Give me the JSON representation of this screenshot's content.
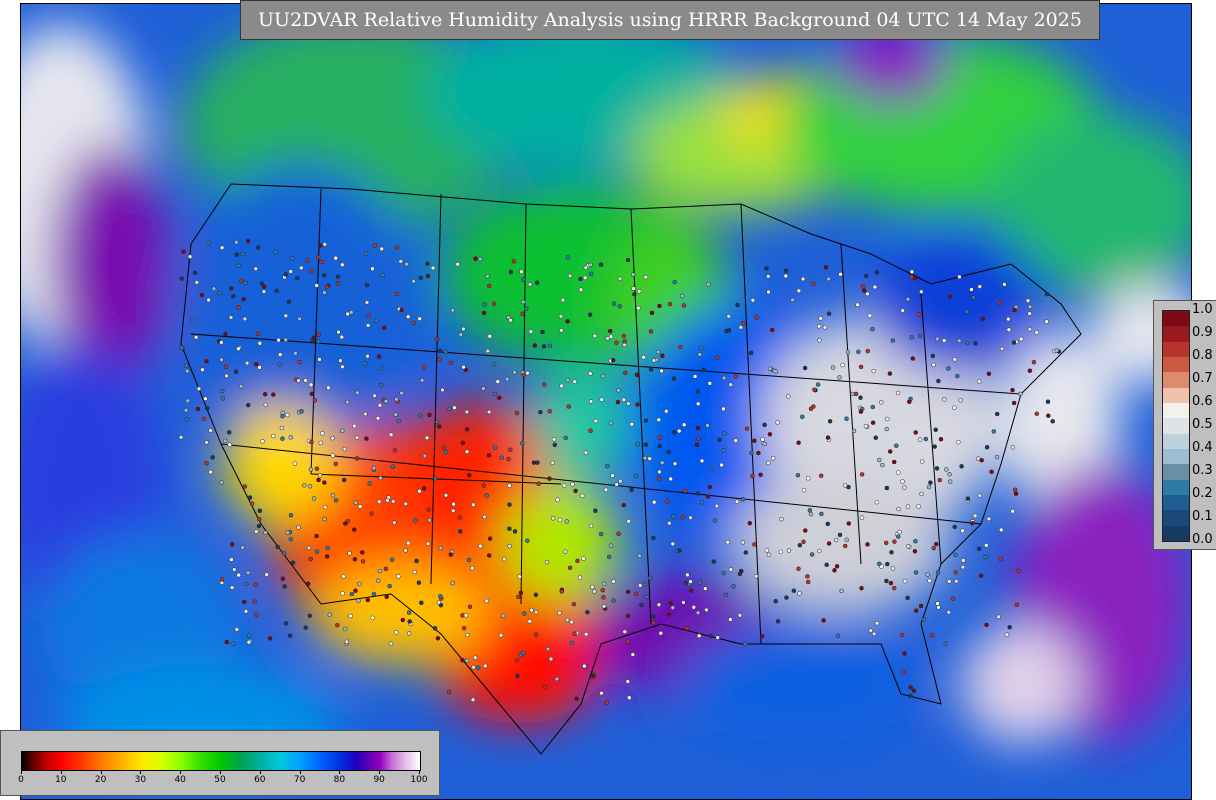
{
  "title": "UU2DVAR Relative Humidity Analysis using HRRR Background 04 UTC 14 May 2025",
  "side_legend": {
    "ticks": [
      "1.0",
      "0.9",
      "0.8",
      "0.7",
      "0.6",
      "0.5",
      "0.4",
      "0.3",
      "0.2",
      "0.1",
      "0.0"
    ],
    "colors": [
      "#7a0a14",
      "#9a1820",
      "#b8332c",
      "#cc5a40",
      "#de8a6e",
      "#f0c2ac",
      "#f4f0ec",
      "#dfe3e6",
      "#bcd2df",
      "#9cbdd4",
      "#6a8ea6",
      "#2f7ba8",
      "#1f5d94",
      "#1a4878",
      "#173a62"
    ]
  },
  "bottom_legend": {
    "ticks": [
      "0",
      "10",
      "20",
      "30",
      "40",
      "50",
      "60",
      "70",
      "80",
      "90",
      "100"
    ]
  }
}
